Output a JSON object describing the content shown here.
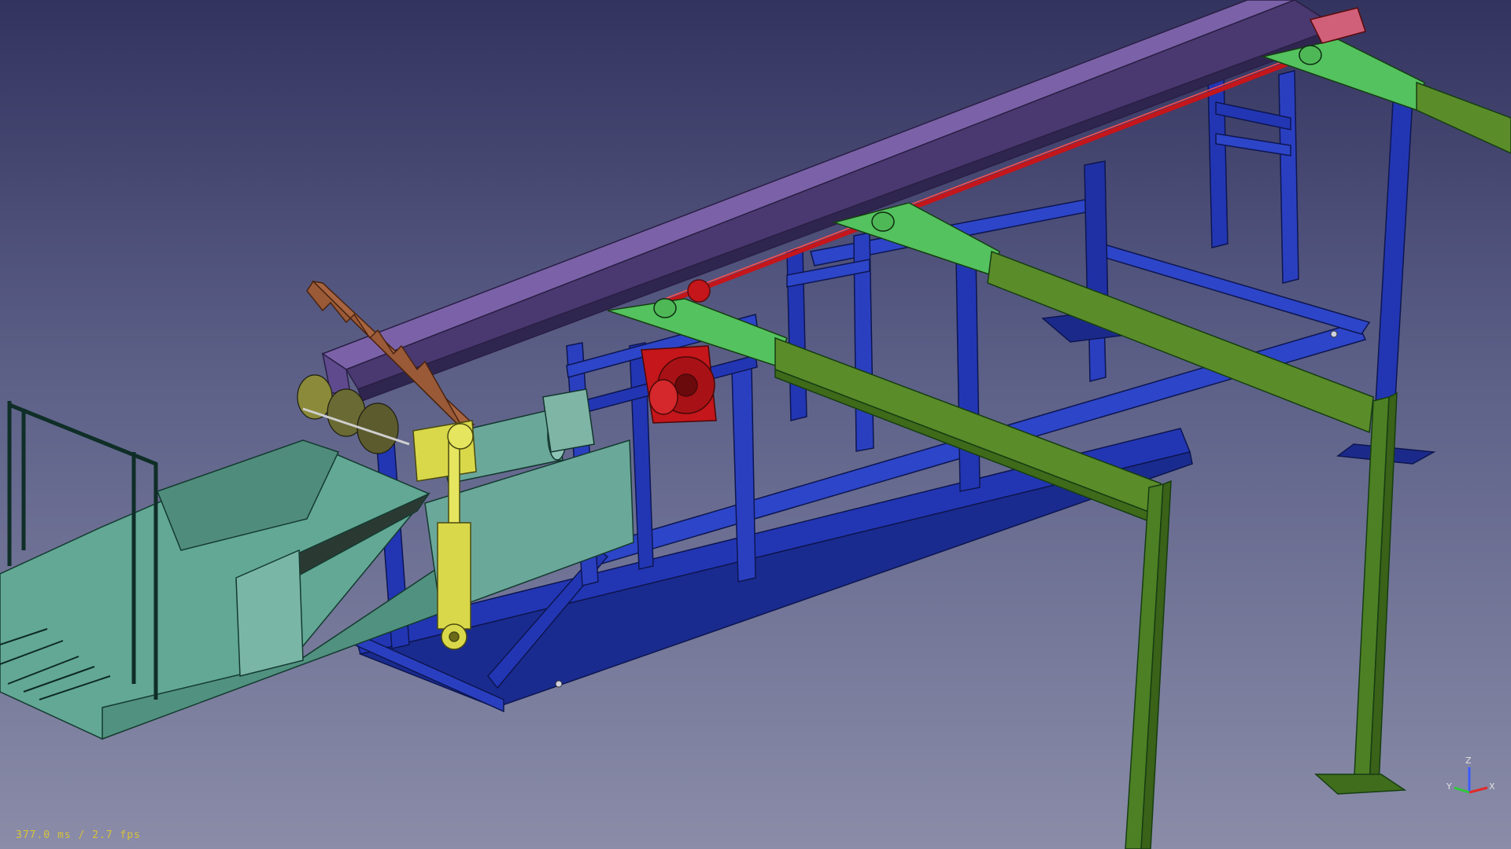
{
  "viewer": {
    "fps_readout": "377.0 ms / 2.7 fps",
    "axis_labels": {
      "x": "X",
      "y": "Y",
      "z": "Z"
    }
  },
  "colors": {
    "frame_blue": "#2236b4",
    "cross_green": "#5a8c2a",
    "bright_green": "#54c25e",
    "purple_rail": "#7b62a8",
    "red_shaft": "#c4161b",
    "hopper_teal": "#62a895",
    "yellow_cylinder": "#d9d84a",
    "brown_rack": "#9a5a38",
    "background_top": "#33335f",
    "background_bottom": "#8a8ca8",
    "fps_text": "#d8c23a"
  }
}
